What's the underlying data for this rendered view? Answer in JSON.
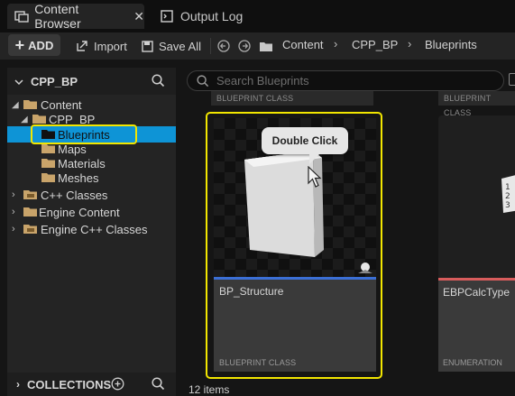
{
  "tabs": [
    {
      "label": "Content Browser",
      "active": true
    },
    {
      "label": "Output Log",
      "active": false
    }
  ],
  "toolbar": {
    "add_label": "ADD",
    "import_label": "Import",
    "save_all_label": "Save All",
    "breadcrumbs": [
      "Content",
      "CPP_BP",
      "Blueprints"
    ]
  },
  "sidebar": {
    "title": "CPP_BP",
    "tree": [
      {
        "label": "Content"
      },
      {
        "label": "CPP_BP"
      },
      {
        "label": "Blueprints",
        "selected": true
      },
      {
        "label": "Maps"
      },
      {
        "label": "Materials"
      },
      {
        "label": "Meshes"
      },
      {
        "label": "C++ Classes"
      },
      {
        "label": "Engine Content"
      },
      {
        "label": "Engine C++ Classes"
      }
    ],
    "collections_label": "COLLECTIONS"
  },
  "search": {
    "placeholder": "Search Blueprints"
  },
  "assets": {
    "row_above_left_class": "BLUEPRINT CLASS",
    "row_above_right_class": "BLUEPRINT CLASS",
    "selected": {
      "name": "BP_Structure",
      "class": "BLUEPRINT CLASS"
    },
    "second": {
      "name": "EBPCalcType",
      "class": "ENUMERATION"
    }
  },
  "tooltip": {
    "text": "Double Click"
  },
  "status": {
    "items_count": "12 items"
  },
  "colors": {
    "selection_blue": "#0e94d6",
    "highlight_yellow": "#f2e600",
    "folder": "#c9a46a",
    "blueprint_line": "#3b6fd6",
    "enum_line": "#d85c5c"
  }
}
